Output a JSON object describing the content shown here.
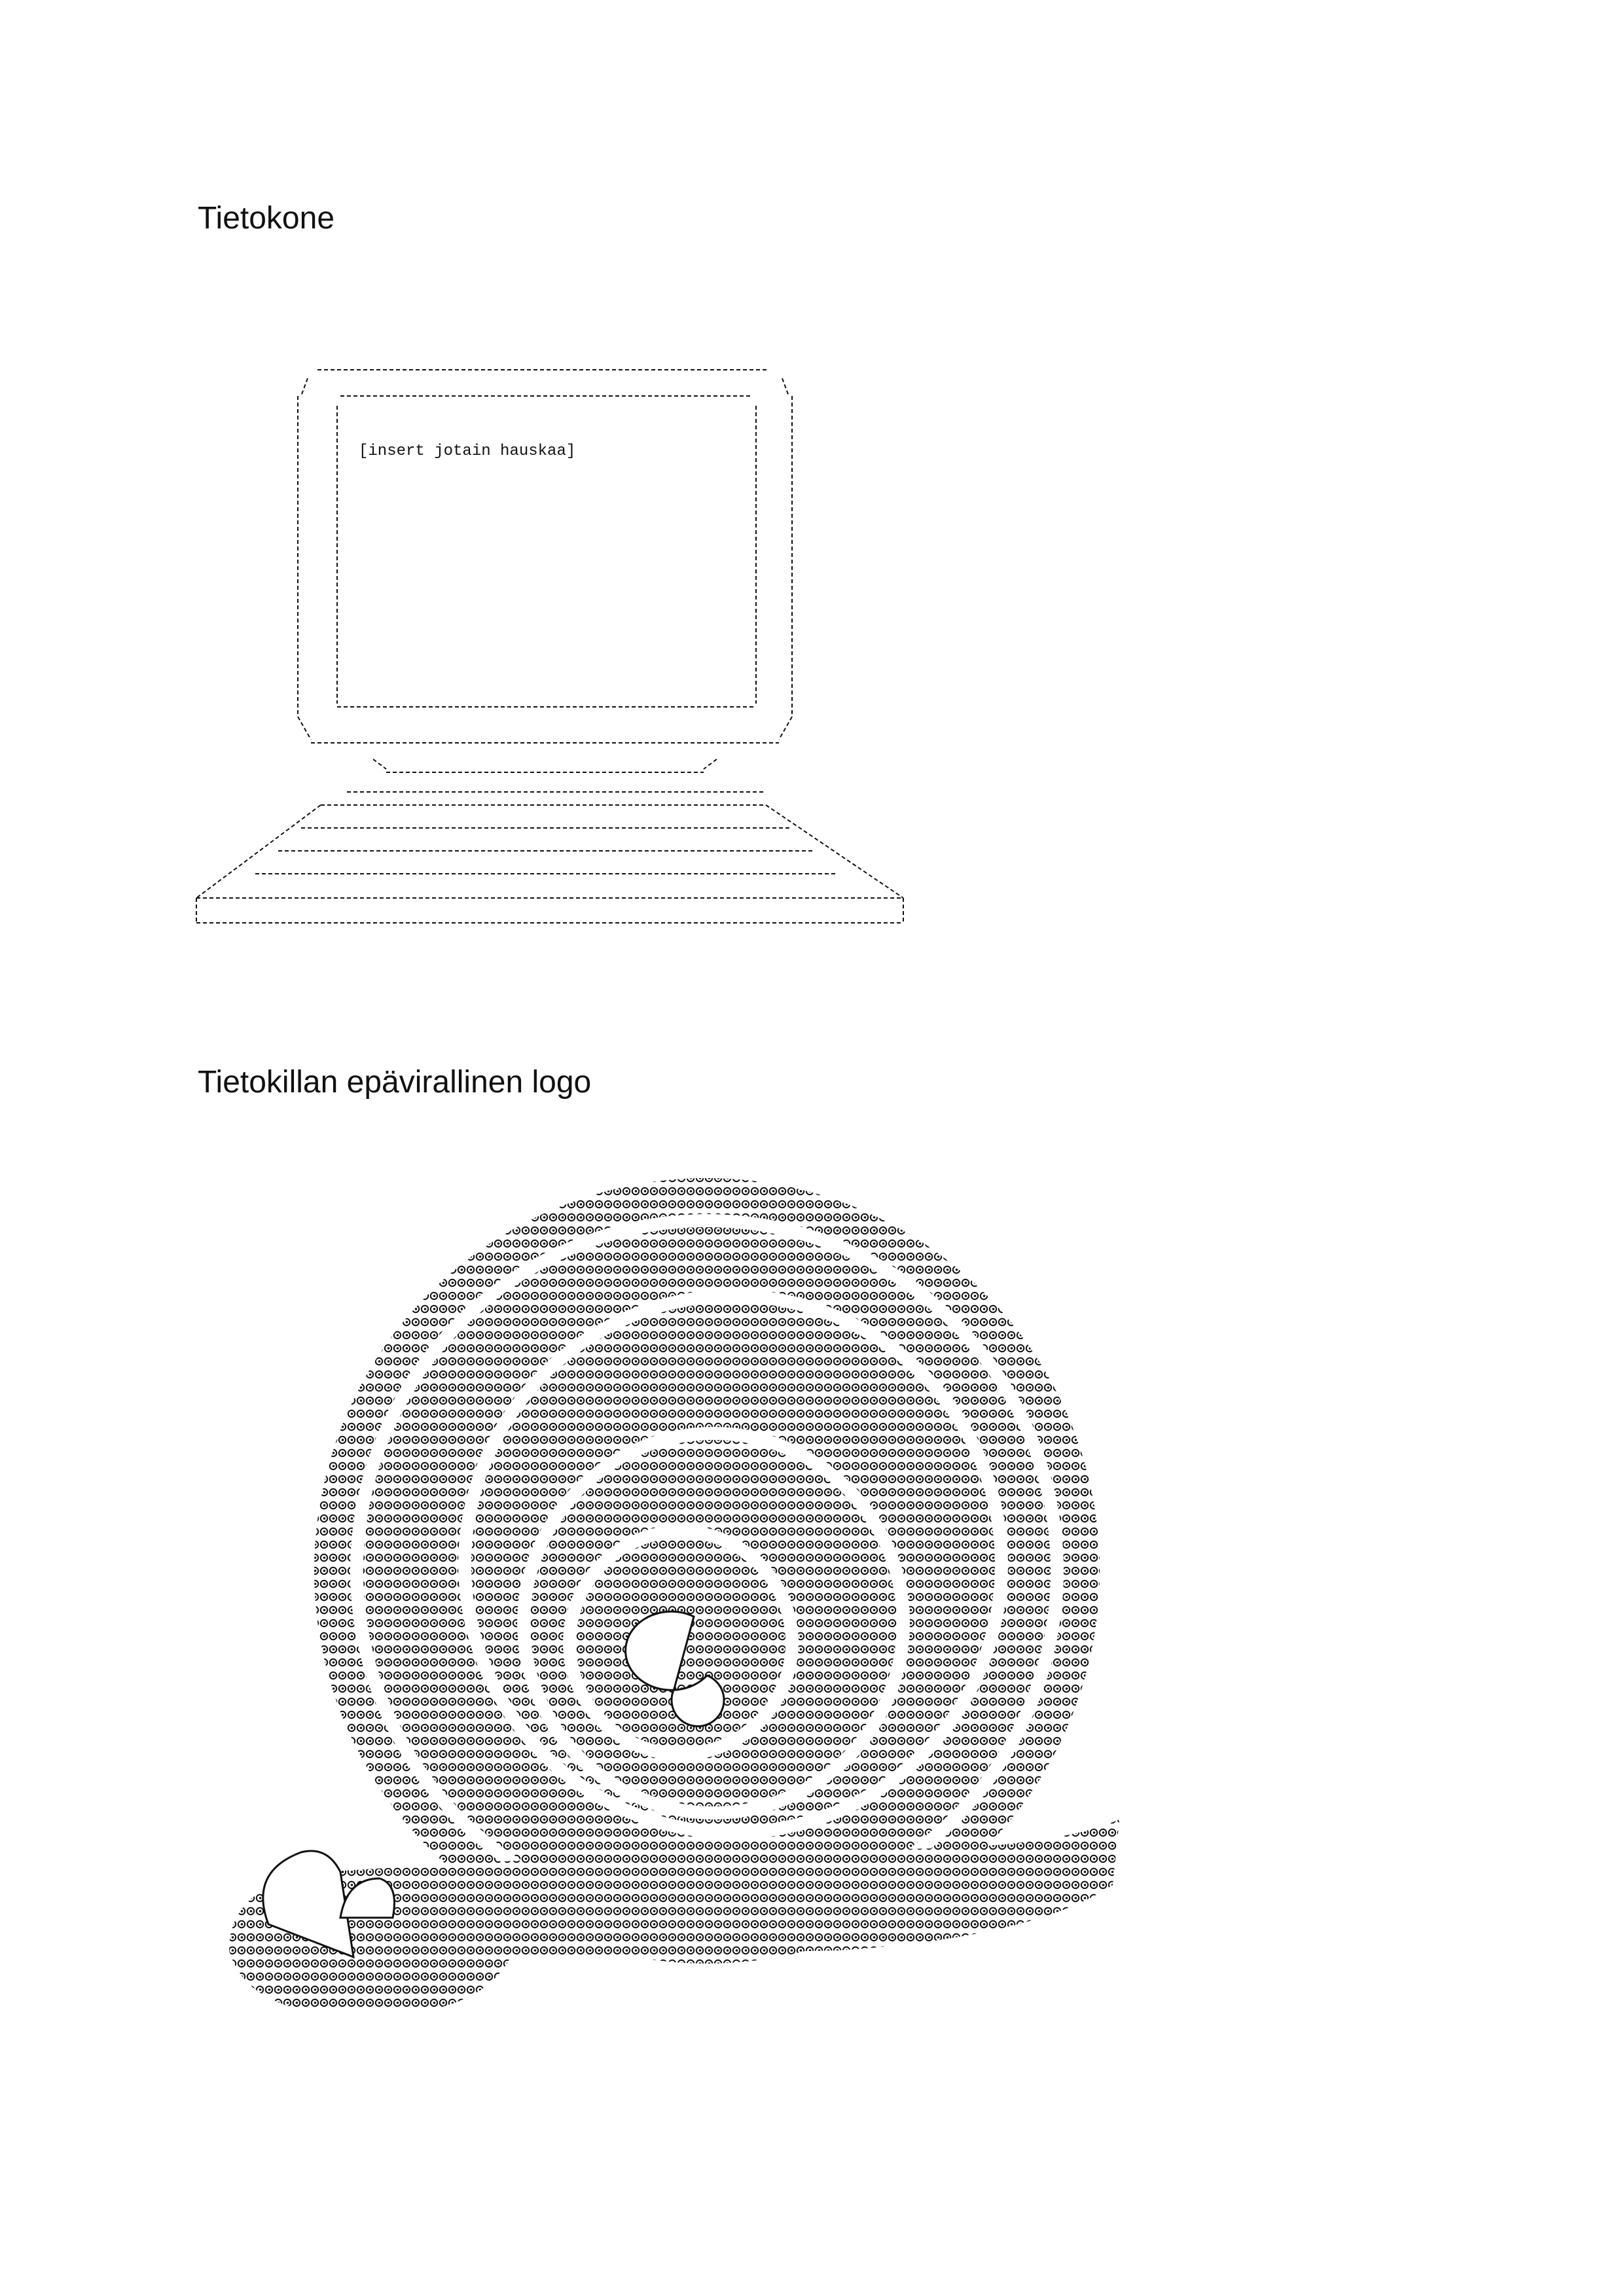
{
  "document": {
    "heading_computer": "Tietokone",
    "screen_text": "[insert jotain hauskaa]",
    "heading_logo": "Tietokillan epävirallinen logo"
  },
  "art": {
    "computer": "ascii-art-computer",
    "logo": "ascii-art-snail-logo"
  }
}
